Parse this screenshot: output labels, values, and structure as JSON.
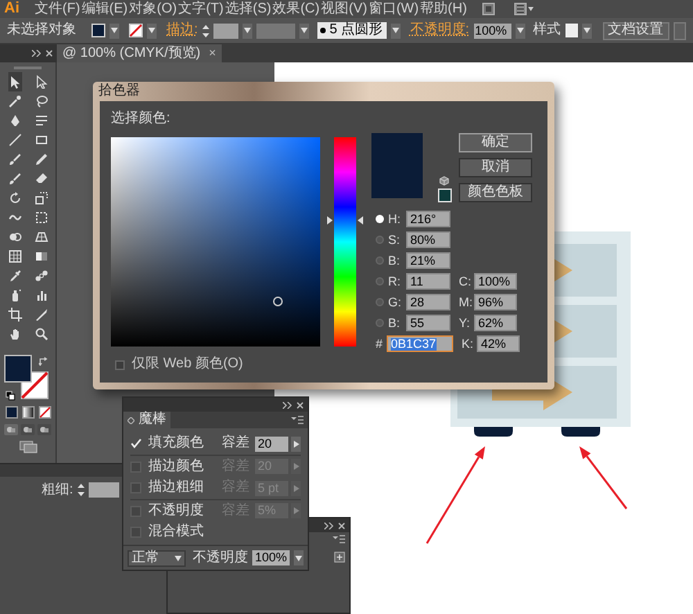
{
  "menu_bar": {
    "logo": "Ai",
    "items": [
      "文件(F)",
      "编辑(E)",
      "对象(O)",
      "文字(T)",
      "选择(S)",
      "效果(C)",
      "视图(V)",
      "窗口(W)",
      "帮助(H)"
    ]
  },
  "control_bar": {
    "selection": "未选择对象",
    "stroke_label": "描边:",
    "brush": "5 点圆形",
    "opacity_label": "不透明度:",
    "opacity": "100%",
    "style_label": "样式",
    "document_setup": "文档设置"
  },
  "document_tab": {
    "title": "@ 100% (CMYK/预览)",
    "close": "×"
  },
  "color_picker": {
    "title": "拾色器",
    "prompt": "选择颜色:",
    "hue_slider": {
      "level": 0.6
    },
    "buttons": [
      "确定",
      "取消",
      "颜色色板"
    ],
    "hsb_rgb": [
      {
        "label": "H:",
        "value": "216°",
        "selected": true
      },
      {
        "label": "S:",
        "value": "80%",
        "selected": false
      },
      {
        "label": "B:",
        "value": "21%",
        "selected": false
      },
      {
        "label": "R:",
        "value": "11",
        "selected": false
      },
      {
        "label": "G:",
        "value": "28",
        "selected": false
      },
      {
        "label": "B:",
        "value": "55",
        "selected": false
      }
    ],
    "hex_label": "#",
    "hex": "0B1C37",
    "cmyk": [
      {
        "label": "C:",
        "value": "100%"
      },
      {
        "label": "M:",
        "value": "96%"
      },
      {
        "label": "Y:",
        "value": "62%"
      },
      {
        "label": "K:",
        "value": "42%"
      }
    ],
    "web_only": {
      "label": "仅限 Web 颜色(O)",
      "checked": false
    }
  },
  "magic_wand_panel": {
    "tab": "魔棒",
    "options": [
      {
        "label": "填充颜色",
        "checked": true,
        "tolerance_label": "容差",
        "tolerance": "20",
        "disabled": false
      },
      {
        "label": "描边颜色",
        "checked": false,
        "tolerance_label": "容差",
        "tolerance": "20",
        "disabled": true
      },
      {
        "label": "描边粗细",
        "checked": false,
        "tolerance_label": "容差",
        "tolerance": "5 pt",
        "disabled": true
      },
      {
        "label": "不透明度",
        "checked": false,
        "tolerance_label": "容差",
        "tolerance": "5%",
        "disabled": true
      },
      {
        "label": "混合模式",
        "checked": false
      }
    ],
    "blend_mode": "正常",
    "opacity_label": "不透明度",
    "opacity": "100%"
  },
  "stroke_panel": {
    "weight_label": "粗细:"
  }
}
